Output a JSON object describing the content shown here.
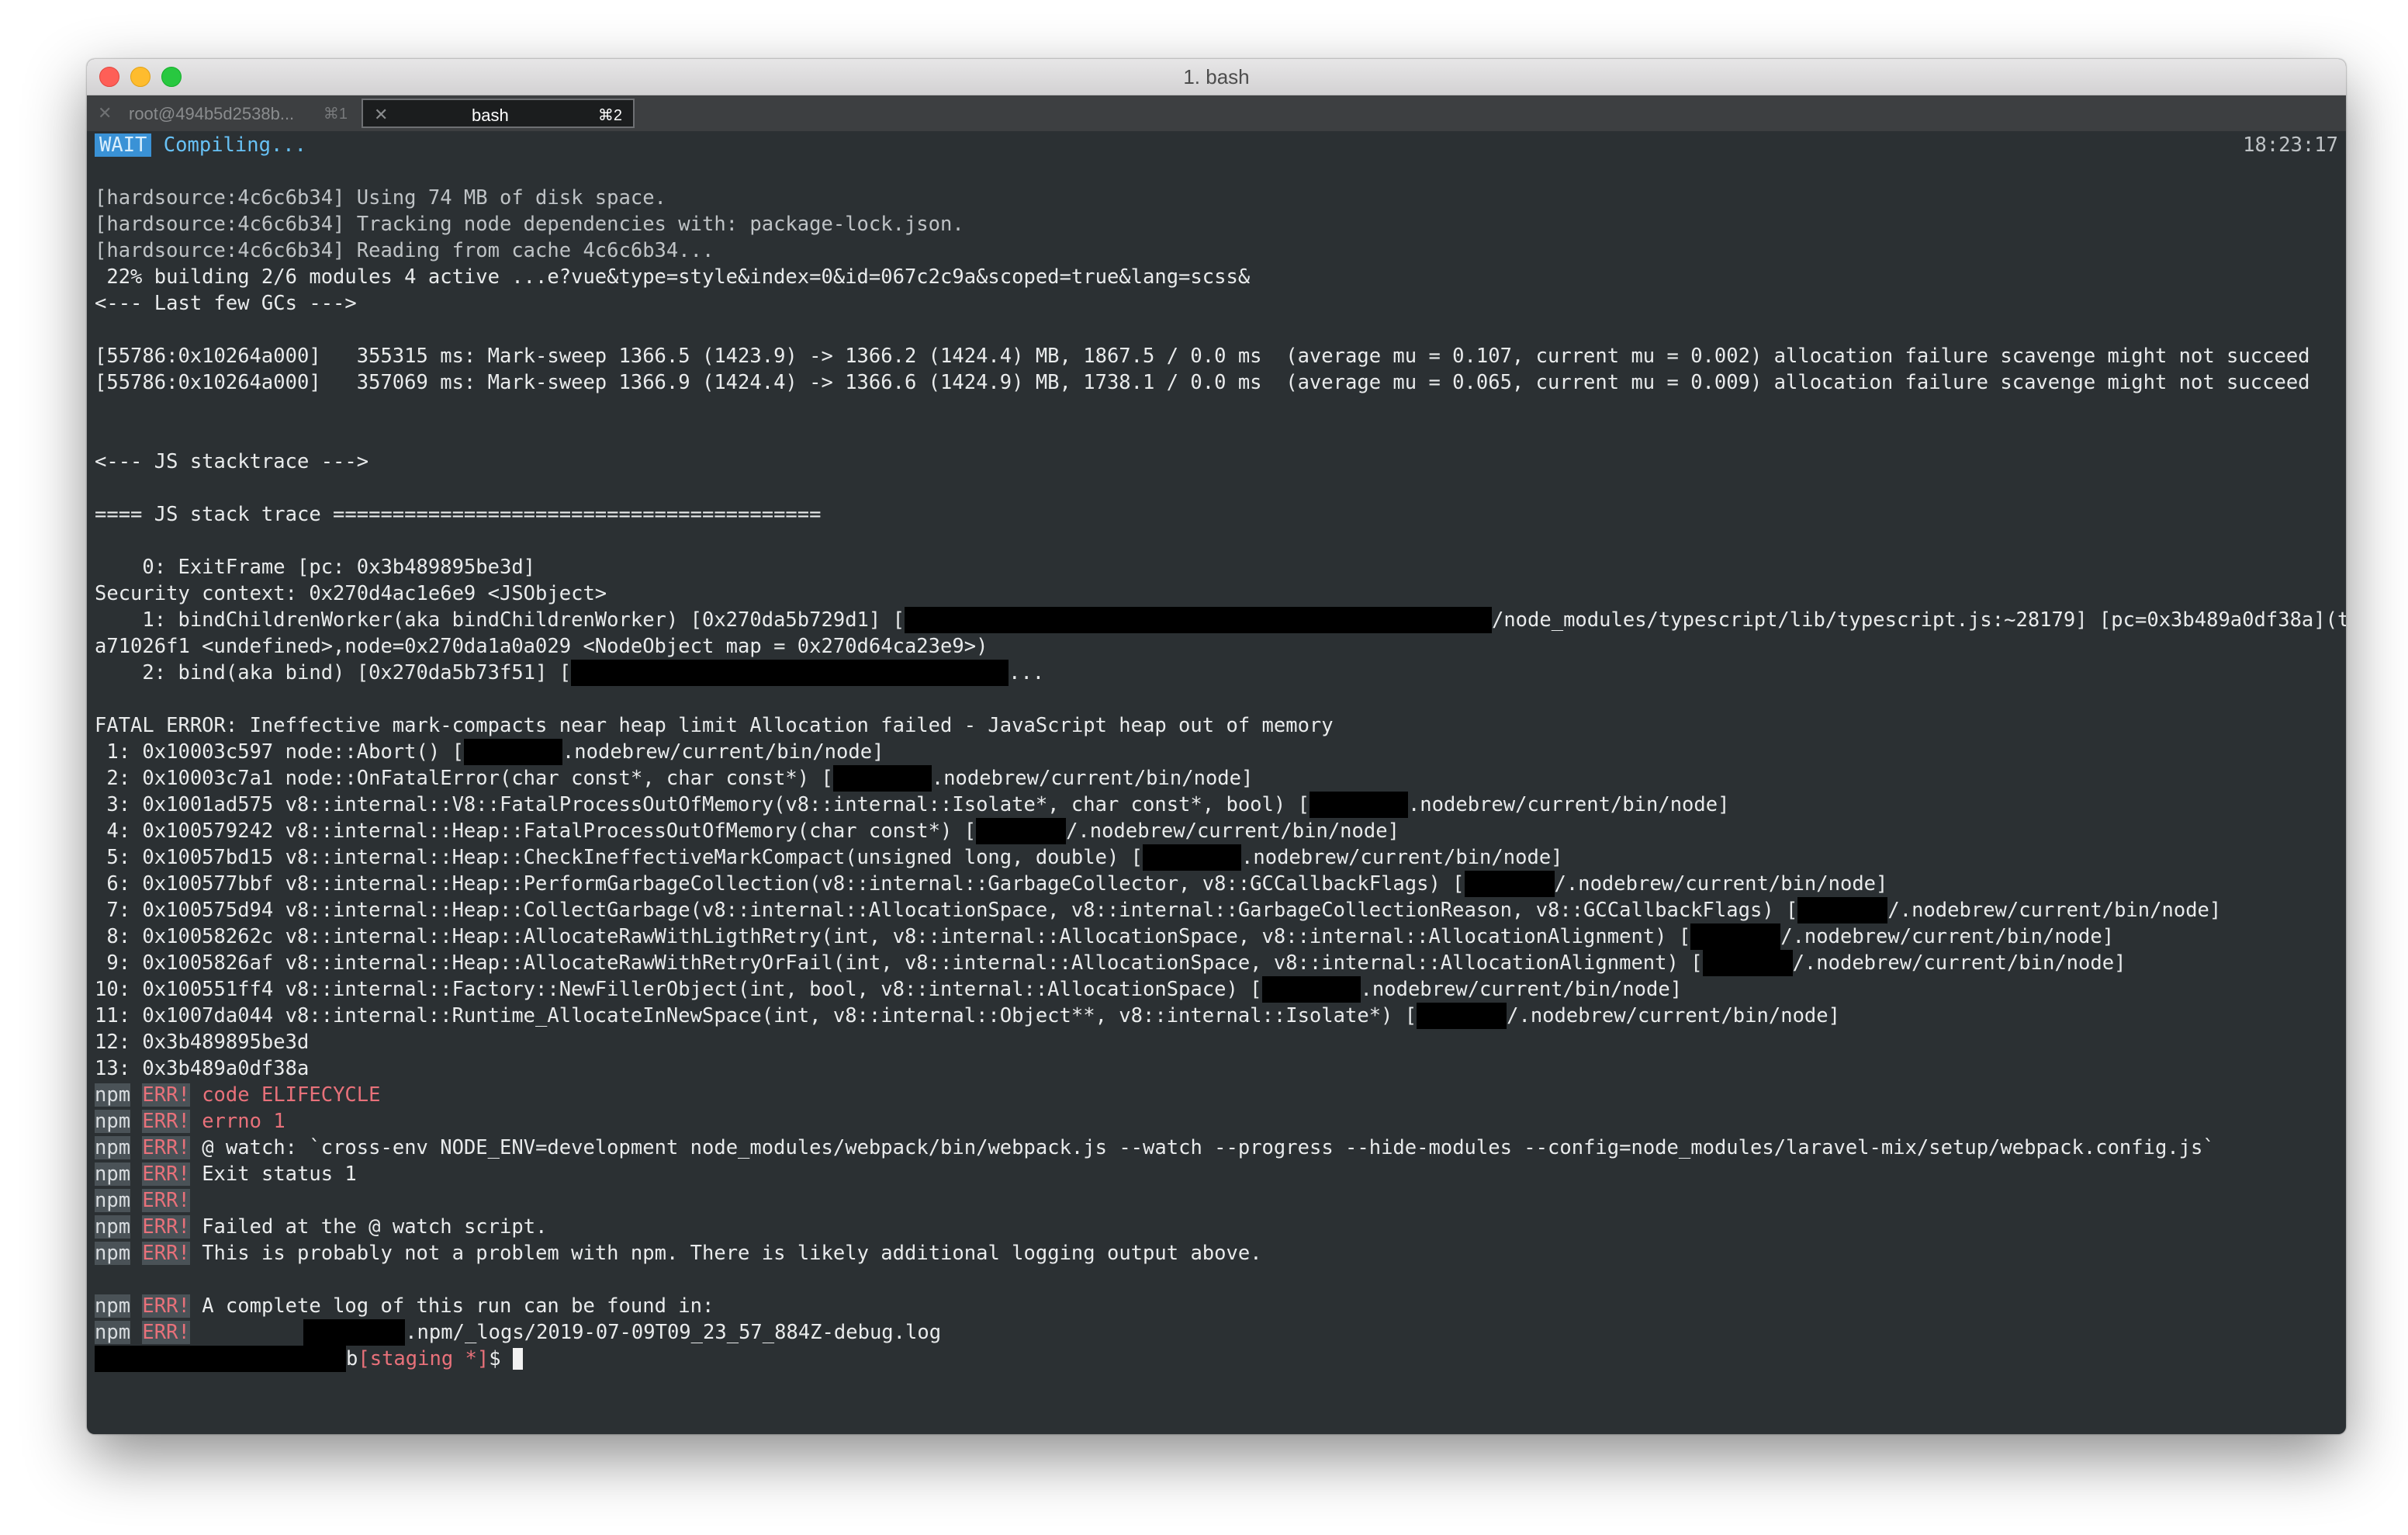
{
  "window": {
    "title": "1. bash",
    "tabs": [
      {
        "label": "root@494b5d2538b...",
        "shortcut": "⌘1",
        "active": false
      },
      {
        "label": "bash",
        "shortcut": "⌘2",
        "active": true
      }
    ]
  },
  "terminal": {
    "status": {
      "badge": "WAIT",
      "text": "Compiling...",
      "time": "18:23:17"
    },
    "lines": [
      "[hardsource:4c6c6b34] Using 74 MB of disk space.",
      "[hardsource:4c6c6b34] Tracking node dependencies with: package-lock.json.",
      "[hardsource:4c6c6b34] Reading from cache 4c6c6b34...",
      " 22% building 2/6 modules 4 active ...e?vue&type=style&index=0&id=067c2c9a&scoped=true&lang=scss&",
      "<--- Last few GCs --->",
      "[55786:0x10264a000]   355315 ms: Mark-sweep 1366.5 (1423.9) -> 1366.2 (1424.4) MB, 1867.5 / 0.0 ms  (average mu = 0.107, current mu = 0.002) allocation failure scavenge might not succeed",
      "[55786:0x10264a000]   357069 ms: Mark-sweep 1366.9 (1424.4) -> 1366.6 (1424.9) MB, 1738.1 / 0.0 ms  (average mu = 0.065, current mu = 0.009) allocation failure scavenge might not succeed",
      "<--- JS stacktrace --->",
      "==== JS stack trace =========================================",
      "    0: ExitFrame [pc: 0x3b489895be3d]",
      "Security context: 0x270d4ac1e6e9 <JSObject>",
      "    1: bindChildrenWorker(aka bindChildrenWorker) [0x270da5b729d1] [",
      "/node_modules/typescript/lib/typescript.js:~28179] [pc=0x3b489a0df38a](this=0x270d",
      "a71026f1 <undefined>,node=0x270da1a0a029 <NodeObject map = 0x270d64ca23e9>)",
      "    2: bind(aka bind) [0x270da5b73f51] [",
      "...",
      "FATAL ERROR: Ineffective mark-compacts near heap limit Allocation failed - JavaScript heap out of memory",
      " 1: 0x10003c597 node::Abort() [",
      " 2: 0x10003c7a1 node::OnFatalError(char const*, char const*) [",
      " 3: 0x1001ad575 v8::internal::V8::FatalProcessOutOfMemory(v8::internal::Isolate*, char const*, bool) [",
      " 4: 0x100579242 v8::internal::Heap::FatalProcessOutOfMemory(char const*) [",
      " 5: 0x10057bd15 v8::internal::Heap::CheckIneffectiveMarkCompact(unsigned long, double) [",
      " 6: 0x100577bbf v8::internal::Heap::PerformGarbageCollection(v8::internal::GarbageCollector, v8::GCCallbackFlags) [",
      " 7: 0x100575d94 v8::internal::Heap::CollectGarbage(v8::internal::AllocationSpace, v8::internal::GarbageCollectionReason, v8::GCCallbackFlags) [",
      " 8: 0x10058262c v8::internal::Heap::AllocateRawWithLigthRetry(int, v8::internal::AllocationSpace, v8::internal::AllocationAlignment) [",
      " 9: 0x1005826af v8::internal::Heap::AllocateRawWithRetryOrFail(int, v8::internal::AllocationSpace, v8::internal::AllocationAlignment) [",
      "10: 0x100551ff4 v8::internal::Factory::NewFillerObject(int, bool, v8::internal::AllocationSpace) [",
      "11: 0x1007da044 v8::internal::Runtime_AllocateInNewSpace(int, v8::internal::Object**, v8::internal::Isolate*) [",
      "12: 0x3b489895be3d",
      "13: 0x3b489a0df38a"
    ],
    "node_path_a": ".nodebrew/current/bin/node]",
    "node_path_b": "/.nodebrew/current/bin/node]",
    "npm": {
      "prefix": "npm",
      "err": "ERR!",
      "messages": [
        "code ELIFECYCLE",
        "errno 1",
        "@ watch: `cross-env NODE_ENV=development node_modules/webpack/bin/webpack.js --watch --progress --hide-modules --config=node_modules/laravel-mix/setup/webpack.config.js`",
        "Exit status 1",
        "",
        "Failed at the @ watch script.",
        "This is probably not a problem with npm. There is likely additional logging output above.",
        "A complete log of this run can be found in:",
        ".npm/_logs/2019-07-09T09_23_57_884Z-debug.log"
      ]
    },
    "prompt": {
      "branch_end": "b",
      "branch": "[staging *]",
      "symbol": "$ "
    }
  }
}
